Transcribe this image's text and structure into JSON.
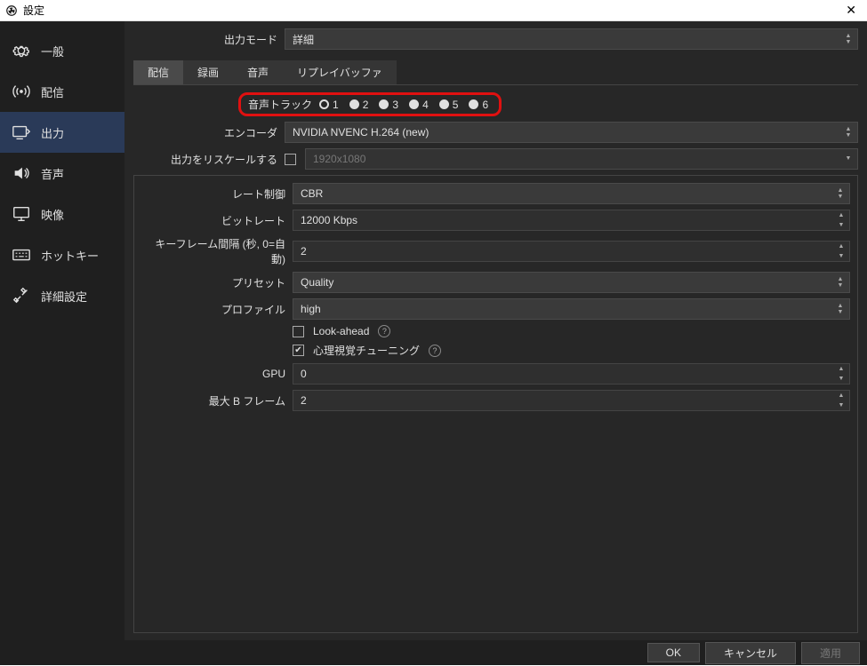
{
  "titlebar": {
    "title": "設定"
  },
  "sidebar": [
    {
      "label": "一般"
    },
    {
      "label": "配信"
    },
    {
      "label": "出力"
    },
    {
      "label": "音声"
    },
    {
      "label": "映像"
    },
    {
      "label": "ホットキー"
    },
    {
      "label": "詳細設定"
    }
  ],
  "output_mode": {
    "label": "出力モード",
    "value": "詳細"
  },
  "tabs": {
    "stream": "配信",
    "record": "録画",
    "audio": "音声",
    "replay": "リプレイバッファ"
  },
  "audio_track": {
    "label": "音声トラック",
    "options": [
      "1",
      "2",
      "3",
      "4",
      "5",
      "6"
    ]
  },
  "encoder": {
    "label": "エンコーダ",
    "value": "NVIDIA NVENC H.264 (new)"
  },
  "rescale": {
    "label": "出力をリスケールする",
    "placeholder": "1920x1080"
  },
  "rate_control": {
    "label": "レート制御",
    "value": "CBR"
  },
  "bitrate": {
    "label": "ビットレート",
    "value": "12000 Kbps"
  },
  "keyframe": {
    "label": "キーフレーム間隔 (秒, 0=自動)",
    "value": "2"
  },
  "preset": {
    "label": "プリセット",
    "value": "Quality"
  },
  "profile": {
    "label": "プロファイル",
    "value": "high"
  },
  "lookahead": {
    "label": "Look-ahead"
  },
  "psycho": {
    "label": "心理視覚チューニング"
  },
  "gpu": {
    "label": "GPU",
    "value": "0"
  },
  "bframes": {
    "label": "最大 B フレーム",
    "value": "2"
  },
  "buttons": {
    "ok": "OK",
    "cancel": "キャンセル",
    "apply": "適用"
  }
}
